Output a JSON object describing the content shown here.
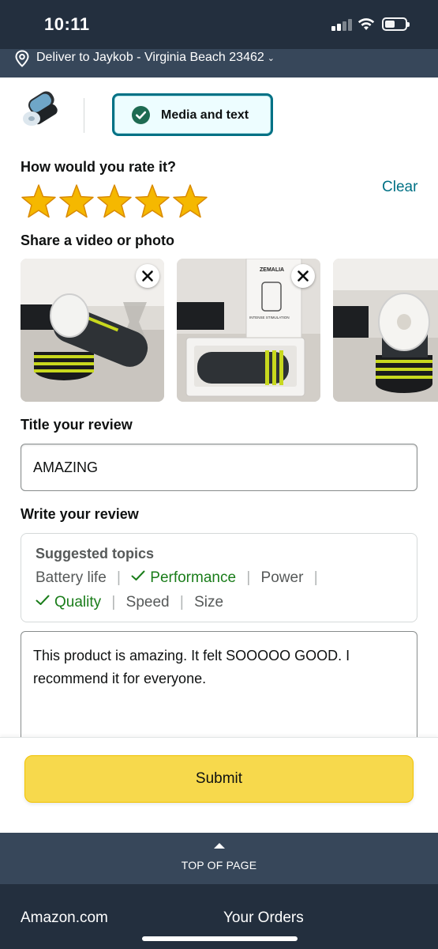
{
  "status_bar": {
    "time": "10:11"
  },
  "delivery": {
    "text": "Deliver to Jaykob - Virginia Beach 23462"
  },
  "media_option": {
    "label": "Media and text",
    "selected": true
  },
  "rating": {
    "question": "How would you rate it?",
    "clear_label": "Clear",
    "stars": 5,
    "max_stars": 5,
    "star_color": "#f5b800"
  },
  "media": {
    "heading": "Share a video or photo",
    "photos": [
      {
        "alt": "Product photo 1",
        "removable": true
      },
      {
        "alt": "Product photo 2 with box",
        "removable": true
      },
      {
        "alt": "Product photo 3",
        "removable": false
      }
    ],
    "box_brand": "ZEMALIA",
    "box_caption": "INTENSE STIMULATION"
  },
  "title_section": {
    "heading": "Title your review",
    "value": "AMAZING"
  },
  "review_section": {
    "heading": "Write your review",
    "suggested_title": "Suggested topics",
    "topics": [
      {
        "label": "Battery life",
        "selected": false
      },
      {
        "label": "Performance",
        "selected": true
      },
      {
        "label": "Power",
        "selected": false
      },
      {
        "label": "Quality",
        "selected": true
      },
      {
        "label": "Speed",
        "selected": false
      },
      {
        "label": "Size",
        "selected": false
      }
    ],
    "value": "This product is amazing. It felt SOOOOO GOOD. I recommend it for everyone."
  },
  "submit": {
    "label": "Submit"
  },
  "footer": {
    "top_of_page": "TOP OF PAGE",
    "link_home": "Amazon.com",
    "link_orders": "Your Orders"
  },
  "colors": {
    "header": "#232f3e",
    "subheader": "#37475a",
    "accent": "#007185",
    "button": "#f7d94c",
    "selected_topic": "#1a7d1a"
  }
}
